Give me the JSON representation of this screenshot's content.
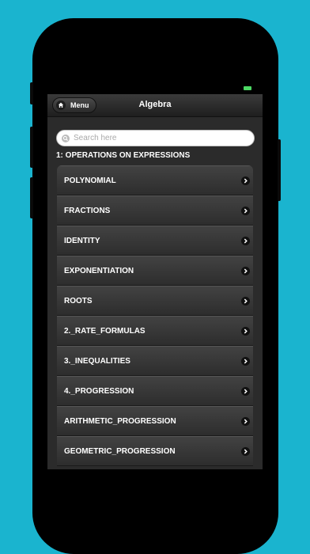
{
  "app": {
    "title": "Algebra",
    "menu_label": "Menu"
  },
  "search": {
    "placeholder": "Search here"
  },
  "section": {
    "title": "1: OPERATIONS ON EXPRESSIONS"
  },
  "items": [
    {
      "label": "POLYNOMIAL"
    },
    {
      "label": "FRACTIONS"
    },
    {
      "label": "IDENTITY"
    },
    {
      "label": "EXPONENTIATION"
    },
    {
      "label": "ROOTS"
    },
    {
      "label": "2._RATE_FORMULAS"
    },
    {
      "label": "3._INEQUALITIES"
    },
    {
      "label": "4._PROGRESSION"
    },
    {
      "label": "ARITHMETIC_PROGRESSION"
    },
    {
      "label": "GEOMETRIC_PROGRESSION"
    }
  ],
  "colors": {
    "background": "#1ab4cf",
    "battery": "#4cd964",
    "list_bg": "#3a3a3a"
  },
  "icons": {
    "home": "home-icon",
    "search": "search-icon",
    "chevron": "chevron-right-icon"
  }
}
